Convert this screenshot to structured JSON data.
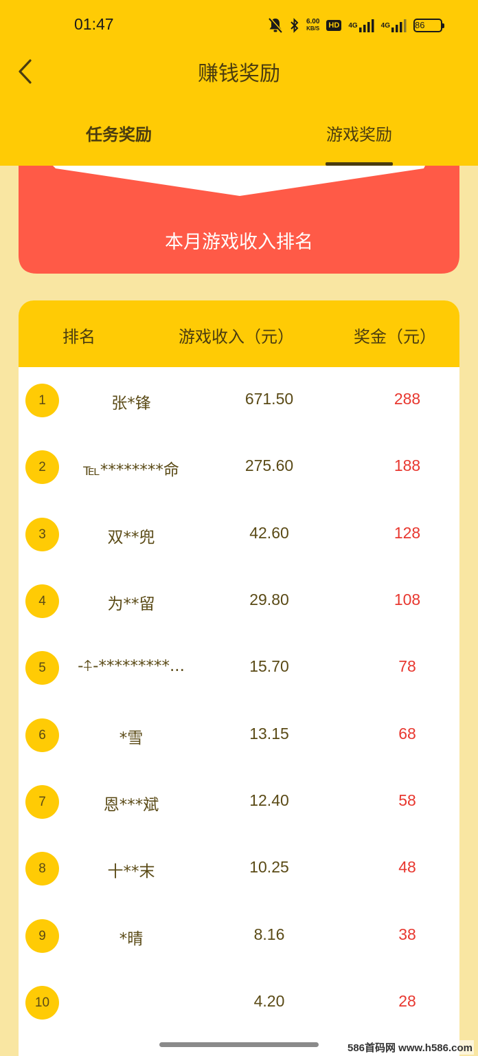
{
  "status_bar": {
    "time": "01:47",
    "net_speed_value": "6.00",
    "net_speed_unit": "KB/S",
    "hd_label": "HD",
    "net1_label": "4G",
    "net2_label": "4G",
    "battery": "86"
  },
  "header": {
    "title": "赚钱奖励",
    "tabs": [
      {
        "label": "任务奖励",
        "active": false
      },
      {
        "label": "游戏奖励",
        "active": true
      }
    ]
  },
  "banner": {
    "title": "本月游戏收入排名"
  },
  "table": {
    "columns": [
      "排名",
      "游戏收入（元）",
      "奖金（元）"
    ],
    "rows": [
      {
        "rank": "1",
        "name": "张*锋",
        "income": "671.50",
        "bonus": "288"
      },
      {
        "rank": "2",
        "name": "℡********命",
        "income": "275.60",
        "bonus": "188"
      },
      {
        "rank": "3",
        "name": "双**兜",
        "income": "42.60",
        "bonus": "128"
      },
      {
        "rank": "4",
        "name": "为**留",
        "income": "29.80",
        "bonus": "108"
      },
      {
        "rank": "5",
        "name": "-⍏-*********...",
        "income": "15.70",
        "bonus": "78"
      },
      {
        "rank": "6",
        "name": "*雪",
        "income": "13.15",
        "bonus": "68"
      },
      {
        "rank": "7",
        "name": "恩***斌",
        "income": "12.40",
        "bonus": "58"
      },
      {
        "rank": "8",
        "name": "十**末",
        "income": "10.25",
        "bonus": "48"
      },
      {
        "rank": "9",
        "name": "*晴",
        "income": "8.16",
        "bonus": "38"
      },
      {
        "rank": "10",
        "name": "",
        "income": "4.20",
        "bonus": "28"
      }
    ]
  },
  "watermark": "586首码网 www.h586.com",
  "colors": {
    "header_yellow": "#ffcb05",
    "page_bg": "#f9e6a2",
    "banner_red": "#ff5a47",
    "bonus_red": "#e8372f",
    "text_brown": "#5a4a16"
  },
  "icons": {
    "back": "chevron-left-icon",
    "mute": "bell-off-icon",
    "bluetooth": "bluetooth-icon",
    "signal": "signal-icon"
  }
}
